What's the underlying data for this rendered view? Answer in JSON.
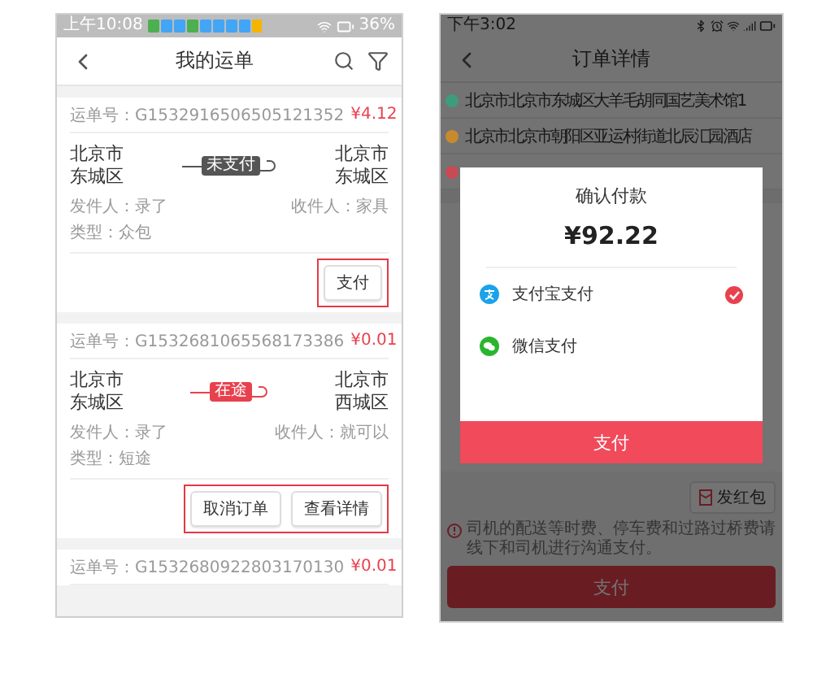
{
  "left_screen": {
    "status_bar": {
      "time": "上午10:08",
      "battery": "36%"
    },
    "title": "我的运单",
    "orders": [
      {
        "number": "运单号：G1532916506505121352",
        "price": "¥4.12",
        "from": [
          "北京市",
          "东城区"
        ],
        "to": [
          "北京市",
          "东城区"
        ],
        "status": "未支付",
        "color": "#555555",
        "sender": "发件人：录了",
        "receiver": "收件人：家具",
        "type": "类型：众包",
        "highlighted": true,
        "actions": [
          "支付"
        ]
      },
      {
        "number": "运单号：G1532681065568173386",
        "price": "¥0.01",
        "from": [
          "北京市",
          "东城区"
        ],
        "to": [
          "北京市",
          "西城区"
        ],
        "status": "在途",
        "color": "#e8414e",
        "sender": "发件人：录了",
        "receiver": "收件人：就可以",
        "type": "类型：短途",
        "highlighted": true,
        "actions": [
          "取消订单",
          "查看详情"
        ]
      },
      {
        "number": "运单号：G1532680922803170130",
        "price": "¥0.01"
      }
    ]
  },
  "right_screen": {
    "status_bar": {
      "time": "下午3:02"
    },
    "title": "订单详情",
    "addresses": [
      {
        "text": "北京市北京市东城区大羊毛胡同国艺美术馆1",
        "color": "#3d9c7c"
      },
      {
        "text": "北京市北京市朝阳区亚运村街道北辰汇园酒店",
        "color": "#c98a2e"
      },
      {
        "color": "#c84a55"
      }
    ],
    "modal": {
      "title": "确认付款",
      "amount": "¥92.22",
      "methods": [
        {
          "label": "支付宝支付",
          "kind": "alipay",
          "selected": true
        },
        {
          "label": "微信支付",
          "kind": "wechat",
          "selected": false
        }
      ],
      "button": "支付"
    },
    "red_packet_button": "发红包",
    "notice": "司机的配送等时费、停车费和过路过桥费请线下和司机进行沟通支付。",
    "pay_button": "支付"
  }
}
